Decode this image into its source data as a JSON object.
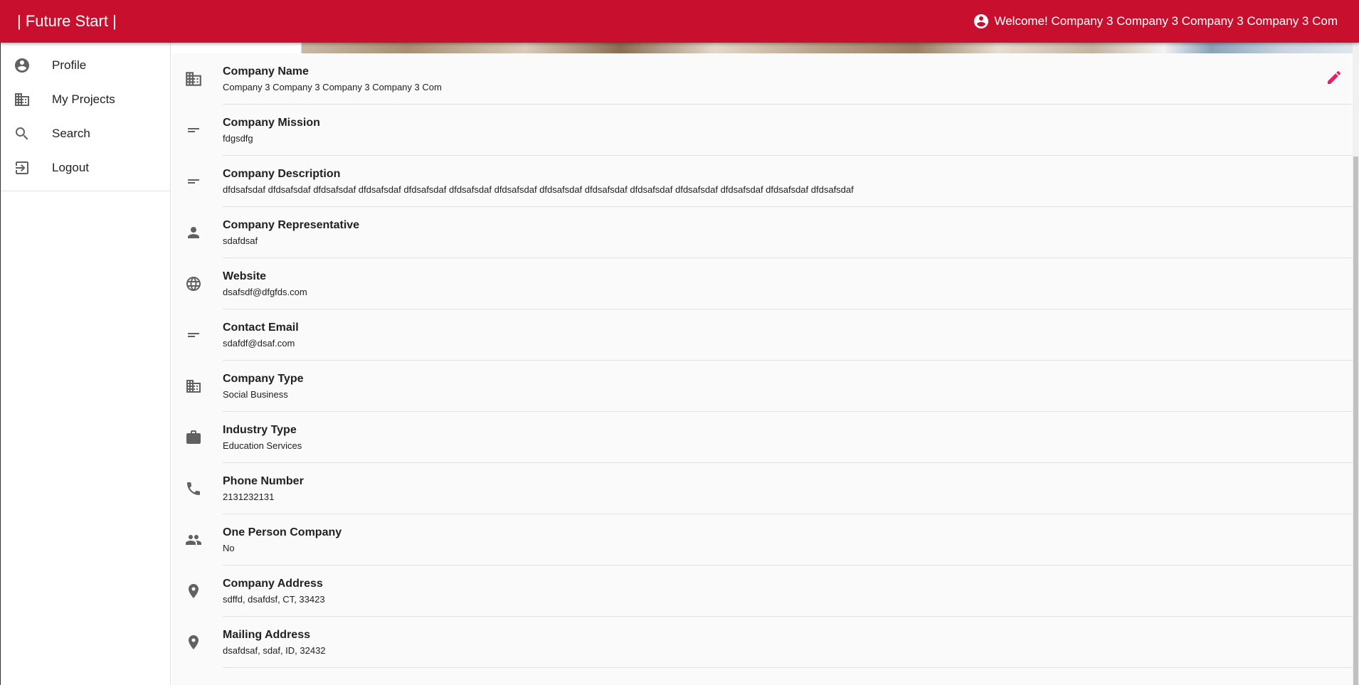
{
  "app": {
    "title": "| Future Start |",
    "welcome": "Welcome! Company 3 Company 3 Company 3 Company 3 Com"
  },
  "sidebar": {
    "items": [
      {
        "label": "Profile",
        "icon": "account-circle-icon"
      },
      {
        "label": "My Projects",
        "icon": "domain-icon"
      },
      {
        "label": "Search",
        "icon": "search-icon"
      },
      {
        "label": "Logout",
        "icon": "logout-icon"
      }
    ]
  },
  "profile": {
    "fields": [
      {
        "label": "Company Name",
        "value": "Company 3 Company 3 Company 3 Company 3 Com",
        "icon": "domain-icon"
      },
      {
        "label": "Company Mission",
        "value": "fdgsdfg",
        "icon": "short-text-icon"
      },
      {
        "label": "Company Description",
        "value": "dfdsafsdaf dfdsafsdaf dfdsafsdaf dfdsafsdaf dfdsafsdaf dfdsafsdaf dfdsafsdaf dfdsafsdaf dfdsafsdaf dfdsafsdaf dfdsafsdaf dfdsafsdaf dfdsafsdaf dfdsafsdaf",
        "icon": "short-text-icon"
      },
      {
        "label": "Company Representative",
        "value": "sdafdsaf",
        "icon": "person-icon"
      },
      {
        "label": "Website",
        "value": "dsafsdf@dfgfds.com",
        "icon": "globe-icon"
      },
      {
        "label": "Contact Email",
        "value": "sdafdf@dsaf.com",
        "icon": "short-text-icon"
      },
      {
        "label": "Company Type",
        "value": "Social Business",
        "icon": "domain-icon"
      },
      {
        "label": "Industry Type",
        "value": "Education Services",
        "icon": "briefcase-icon"
      },
      {
        "label": "Phone Number",
        "value": "2131232131",
        "icon": "phone-icon"
      },
      {
        "label": "One Person Company",
        "value": "No",
        "icon": "people-icon"
      },
      {
        "label": "Company Address",
        "value": "sdffd, dsafdsf, CT, 33423",
        "icon": "location-pin-icon"
      },
      {
        "label": "Mailing Address",
        "value": "dsafdsaf, sdaf, ID, 32432",
        "icon": "location-pin-icon"
      }
    ]
  },
  "colors": {
    "appbar": "#c8102e",
    "edit_icon": "#e91e63",
    "icon": "#616161"
  }
}
